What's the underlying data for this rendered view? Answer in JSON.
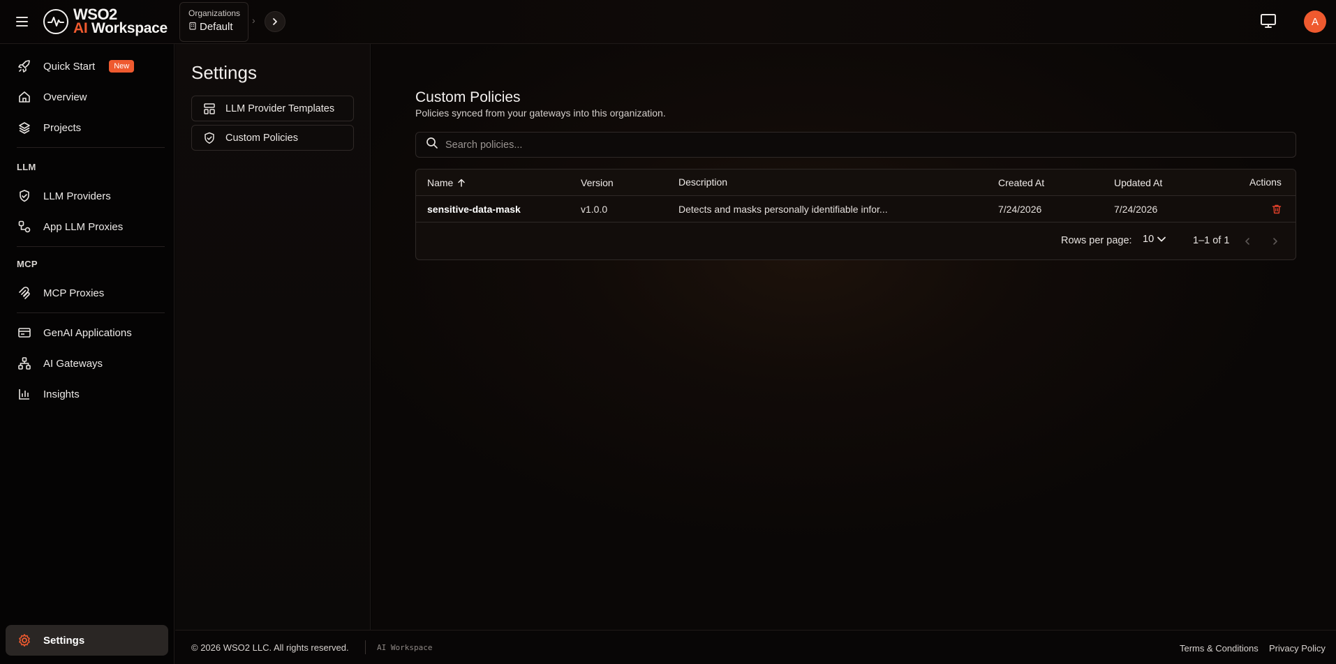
{
  "header": {
    "brand": "WSO2",
    "product_ai": "AI",
    "product_name": "Workspace",
    "org_label": "Organizations",
    "org_value": "Default",
    "avatar_initial": "A"
  },
  "sidebar": {
    "quick_start": "Quick Start",
    "new_badge": "New",
    "overview": "Overview",
    "projects": "Projects",
    "section_llm": "LLM",
    "llm_providers": "LLM Providers",
    "app_llm_proxies": "App LLM Proxies",
    "section_mcp": "MCP",
    "mcp_proxies": "MCP Proxies",
    "genai_applications": "GenAI Applications",
    "ai_gateways": "AI Gateways",
    "insights": "Insights",
    "settings": "Settings"
  },
  "settings_panel": {
    "title": "Settings",
    "items": [
      "LLM Provider Templates",
      "Custom Policies"
    ]
  },
  "main": {
    "title": "Custom Policies",
    "subtitle": "Policies synced from your gateways into this organization.",
    "search_placeholder": "Search policies...",
    "columns": {
      "name": "Name",
      "version": "Version",
      "description": "Description",
      "created_at": "Created At",
      "updated_at": "Updated At",
      "actions": "Actions"
    },
    "rows": [
      {
        "name": "sensitive-data-mask",
        "version": "v1.0.0",
        "description": "Detects and masks personally identifiable infor...",
        "created_at": "7/24/2026",
        "updated_at": "7/24/2026"
      }
    ],
    "pagination": {
      "rows_per_page_label": "Rows per page:",
      "rows_per_page": "10",
      "range": "1–1 of 1"
    }
  },
  "footer": {
    "copyright": "© 2026 WSO2 LLC. All rights reserved.",
    "product": "AI Workspace",
    "terms": "Terms & Conditions",
    "privacy": "Privacy Policy"
  },
  "colors": {
    "accent": "#ef5a2f",
    "danger": "#e0402a"
  }
}
